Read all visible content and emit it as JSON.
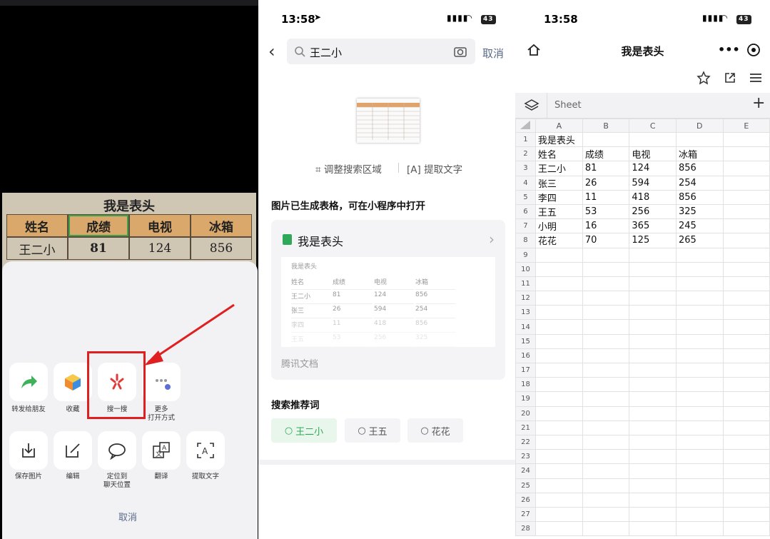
{
  "left": {
    "photo": {
      "title": "我是表头",
      "headers": [
        "姓名",
        "成绩",
        "电视",
        "冰箱"
      ],
      "row": [
        "王二小",
        "81",
        "124",
        "856"
      ]
    },
    "actions_row1": [
      {
        "label": "转发给朋友",
        "icon": "share-arrow-icon"
      },
      {
        "label": "收藏",
        "icon": "favorite-cube-icon"
      },
      {
        "label": "搜一搜",
        "icon": "search-flower-icon"
      },
      {
        "label": "更多\n打开方式",
        "icon": "more-dots-icon"
      }
    ],
    "actions_row2": [
      {
        "label": "保存图片",
        "icon": "save-download-icon"
      },
      {
        "label": "编辑",
        "icon": "edit-pencil-icon"
      },
      {
        "label": "定位到\n聊天位置",
        "icon": "chat-bubble-icon"
      },
      {
        "label": "翻译",
        "icon": "translate-icon"
      },
      {
        "label": "提取文字",
        "icon": "extract-text-icon"
      }
    ],
    "cancel": "取消"
  },
  "middle": {
    "status_time": "13:58",
    "battery": "43",
    "back": "‹",
    "search_value": "王二小",
    "cancel": "取消",
    "adjust": "调整搜索区域",
    "extract": "提取文字",
    "generated_msg": "图片已生成表格，可在小程序中打开",
    "card_title": "我是表头",
    "card_preview": {
      "title": "我是表头",
      "rows": [
        [
          "姓名",
          "成绩",
          "电视",
          "冰箱"
        ],
        [
          "王二小",
          "81",
          "124",
          "856"
        ],
        [
          "张三",
          "26",
          "594",
          "254"
        ],
        [
          "李四",
          "11",
          "418",
          "856"
        ],
        [
          "王五",
          "53",
          "256",
          "325"
        ]
      ]
    },
    "card_source": "腾讯文档",
    "suggest_title": "搜索推荐词",
    "chips": [
      "王二小",
      "王五",
      "花花"
    ]
  },
  "right": {
    "status_time": "13:58",
    "battery": "43",
    "doc_title": "我是表头",
    "sheet_tab": "Sheet",
    "columns": [
      "A",
      "B",
      "C",
      "D",
      "E"
    ],
    "rows": [
      [
        "我是表头",
        "",
        "",
        "",
        ""
      ],
      [
        "姓名",
        "成绩",
        "电视",
        "冰箱",
        ""
      ],
      [
        "王二小",
        "81",
        "124",
        "856",
        ""
      ],
      [
        "张三",
        "26",
        "594",
        "254",
        ""
      ],
      [
        "李四",
        "11",
        "418",
        "856",
        ""
      ],
      [
        "王五",
        "53",
        "256",
        "325",
        ""
      ],
      [
        "小明",
        "16",
        "365",
        "245",
        ""
      ],
      [
        "花花",
        "70",
        "125",
        "265",
        ""
      ],
      [
        "",
        "",
        "",
        "",
        ""
      ],
      [
        "",
        "",
        "",
        "",
        ""
      ],
      [
        "",
        "",
        "",
        "",
        ""
      ],
      [
        "",
        "",
        "",
        "",
        ""
      ],
      [
        "",
        "",
        "",
        "",
        ""
      ],
      [
        "",
        "",
        "",
        "",
        ""
      ],
      [
        "",
        "",
        "",
        "",
        ""
      ],
      [
        "",
        "",
        "",
        "",
        ""
      ],
      [
        "",
        "",
        "",
        "",
        ""
      ],
      [
        "",
        "",
        "",
        "",
        ""
      ],
      [
        "",
        "",
        "",
        "",
        ""
      ],
      [
        "",
        "",
        "",
        "",
        ""
      ],
      [
        "",
        "",
        "",
        "",
        ""
      ],
      [
        "",
        "",
        "",
        "",
        ""
      ],
      [
        "",
        "",
        "",
        "",
        ""
      ],
      [
        "",
        "",
        "",
        "",
        ""
      ],
      [
        "",
        "",
        "",
        "",
        ""
      ],
      [
        "",
        "",
        "",
        "",
        ""
      ],
      [
        "",
        "",
        "",
        "",
        ""
      ],
      [
        "",
        "",
        "",
        "",
        ""
      ]
    ],
    "row_numbers": [
      "1",
      "2",
      "3",
      "4",
      "5",
      "6",
      "7",
      "8",
      "9",
      "10",
      "11",
      "12",
      "13",
      "14",
      "15",
      "16",
      "17",
      "18",
      "19",
      "20",
      "21",
      "22",
      "23",
      "24",
      "25",
      "26",
      "27",
      "28"
    ]
  }
}
